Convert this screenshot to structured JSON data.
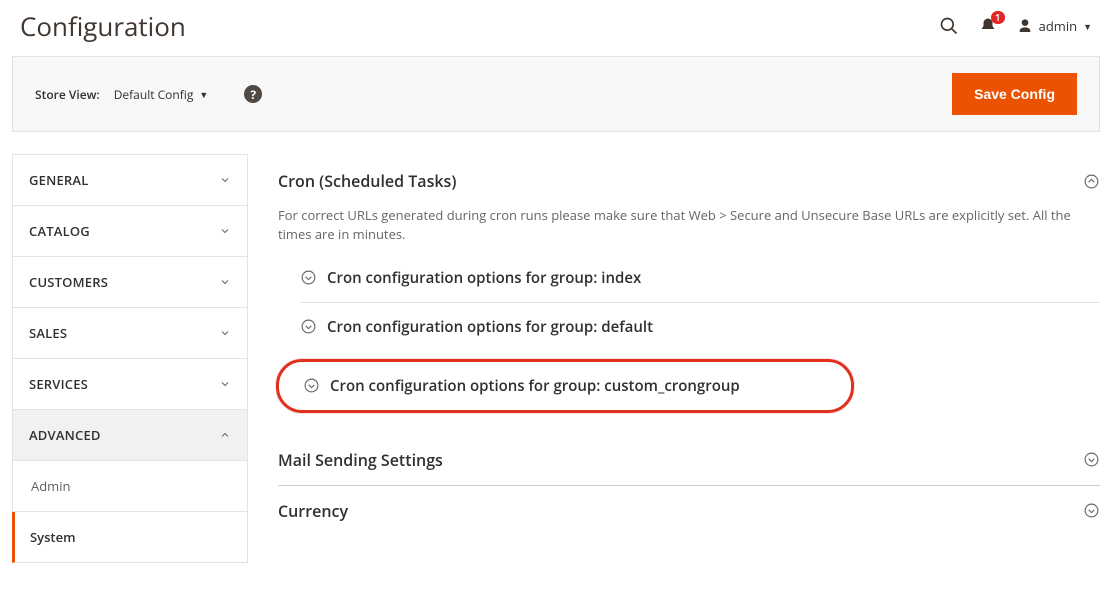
{
  "page_title": "Configuration",
  "header": {
    "notification_count": "1",
    "user_label": "admin"
  },
  "toolbar": {
    "storeview_label": "Store View:",
    "storeview_value": "Default Config",
    "save_label": "Save Config"
  },
  "sidebar": [
    {
      "label": "GENERAL",
      "expanded": false
    },
    {
      "label": "CATALOG",
      "expanded": false
    },
    {
      "label": "CUSTOMERS",
      "expanded": false
    },
    {
      "label": "SALES",
      "expanded": false
    },
    {
      "label": "SERVICES",
      "expanded": false
    },
    {
      "label": "ADVANCED",
      "expanded": true,
      "children": [
        {
          "label": "Admin",
          "active": false
        },
        {
          "label": "System",
          "active": true
        }
      ]
    }
  ],
  "main": {
    "cron": {
      "title": "Cron (Scheduled Tasks)",
      "note": "For correct URLs generated during cron runs please make sure that Web > Secure and Unsecure Base URLs are explicitly set. All the times are in minutes.",
      "groups": [
        {
          "label": "Cron configuration options for group: index"
        },
        {
          "label": "Cron configuration options for group: default"
        },
        {
          "label": "Cron configuration options for group: custom_crongroup",
          "highlight": true
        }
      ]
    },
    "mail": {
      "title": "Mail Sending Settings"
    },
    "currency": {
      "title": "Currency"
    }
  },
  "icons": {
    "search": "search",
    "bell": "bell",
    "user": "user"
  }
}
